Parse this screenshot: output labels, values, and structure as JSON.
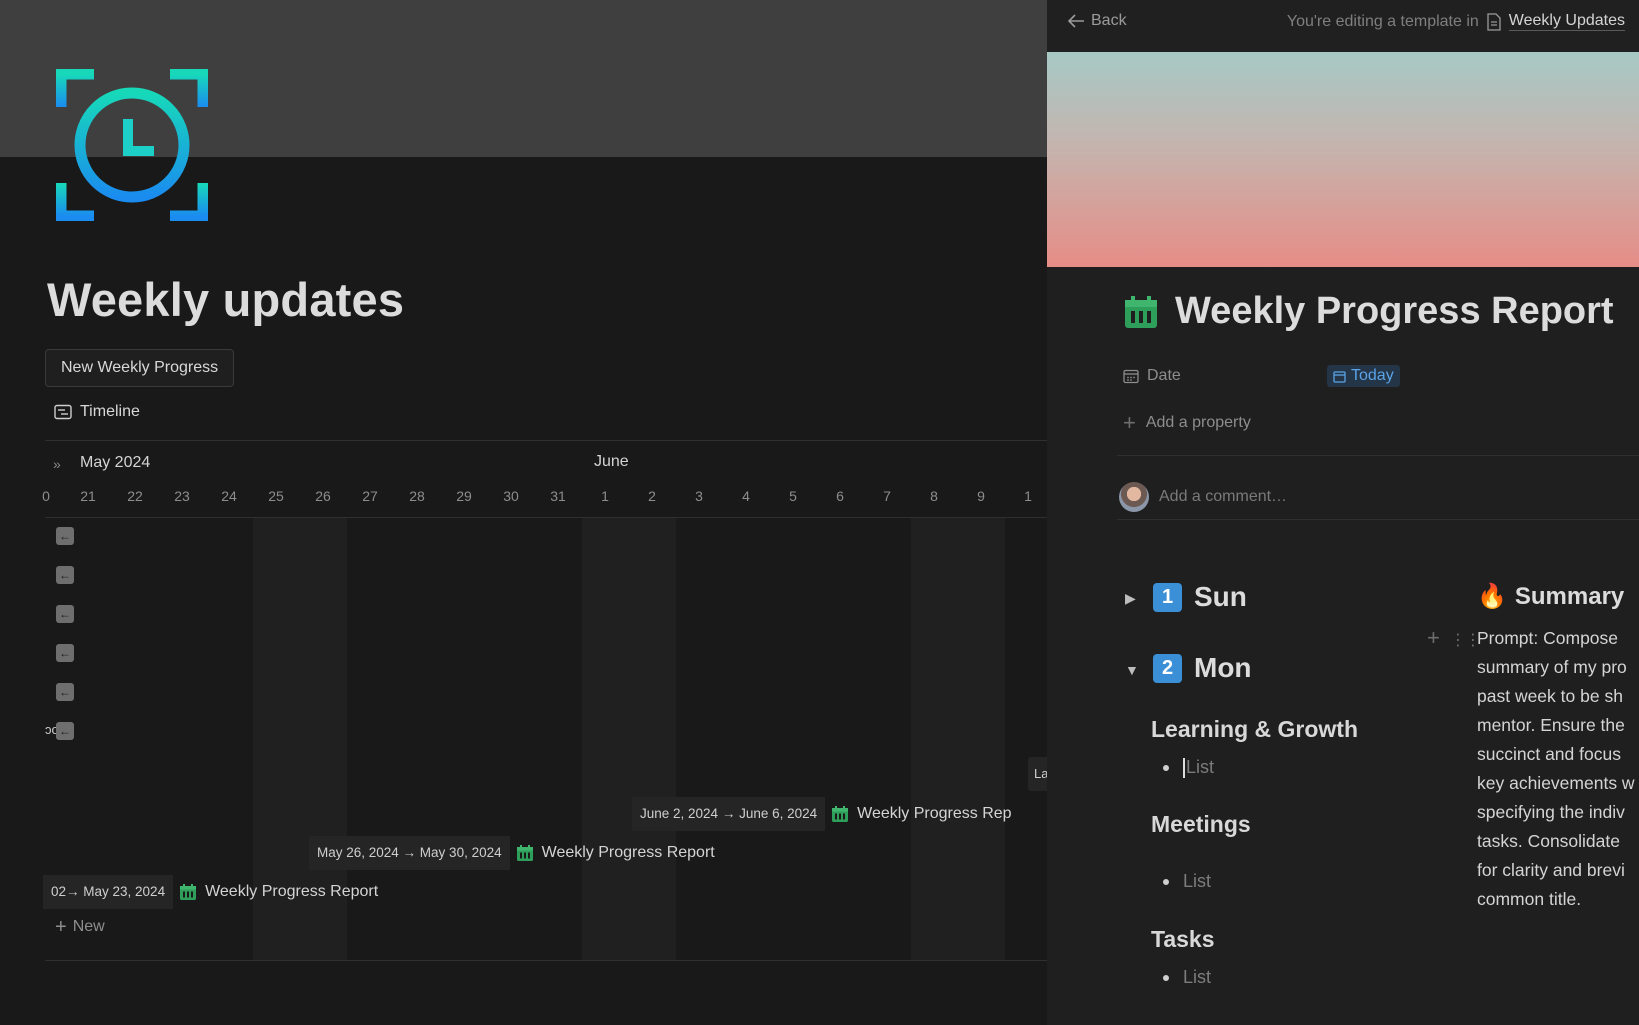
{
  "left": {
    "title": "Weekly updates",
    "new_button": "New Weekly Progress",
    "view_tab": "Timeline",
    "timeline": {
      "month_1": "May 2024",
      "month_2": "June",
      "days": [
        "0",
        "21",
        "22",
        "23",
        "24",
        "25",
        "26",
        "27",
        "28",
        "29",
        "30",
        "31",
        "1",
        "2",
        "3",
        "4",
        "5",
        "6",
        "7",
        "8",
        "9",
        "1"
      ],
      "bars": [
        {
          "dates": "June 2, 2024 → June 6, 2024",
          "name": "Weekly Progress Rep"
        },
        {
          "dates": "May 26, 2024 → May 30, 2024",
          "name": "Weekly Progress Report"
        },
        {
          "dates": "02→ May 23, 2024",
          "name": "Weekly Progress Report"
        }
      ],
      "partial_label": "La",
      "row_partial": "ɔo",
      "new_label": "New"
    }
  },
  "right": {
    "back": "Back",
    "editing_text": "You're editing a template in",
    "template_name": "Weekly Updates",
    "doc_title": "Weekly Progress Report",
    "prop_date_label": "Date",
    "prop_date_value": "Today",
    "add_property": "Add a property",
    "comment_placeholder": "Add a comment…",
    "days": [
      {
        "num": "1",
        "name": "Sun"
      },
      {
        "num": "2",
        "name": "Mon"
      }
    ],
    "sections": [
      {
        "title": "Learning & Growth",
        "item": "List"
      },
      {
        "title": "Meetings",
        "item": "List"
      },
      {
        "title": "Tasks",
        "item": "List"
      }
    ],
    "summary": {
      "icon": "🔥",
      "title": "Summary",
      "lines": [
        "Prompt: Compose",
        "summary of my pro",
        "past week to be sh",
        "mentor. Ensure the",
        "succinct and focus",
        "key achievements w",
        "specifying the indiv",
        "tasks. Consolidate",
        "for clarity and brevi",
        "common title."
      ]
    }
  },
  "colors": {
    "accent_blue": "#3a8fd6",
    "calendar_green": "#2e9e5b",
    "icon_cyan": "#14d1c8",
    "icon_blue": "#1a8fe8"
  },
  "icons": [
    "clock-focus-icon",
    "timeline-icon",
    "double-chevron-icon",
    "arrow-left-icon",
    "calendar-icon",
    "plus-icon",
    "document-icon",
    "drag-handle-icon",
    "fire-icon"
  ]
}
